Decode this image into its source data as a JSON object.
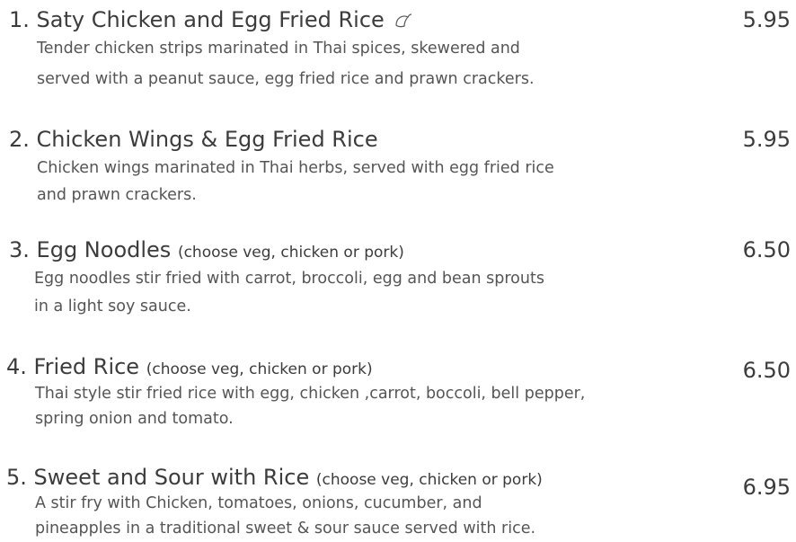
{
  "items": [
    {
      "number": "1.",
      "name": "Saty Chicken and Egg Fried Rice",
      "note": "",
      "icon": "chili-icon",
      "price": "5.95",
      "desc_line1": "Tender chicken strips marinated in Thai spices, skewered and",
      "desc_line2": "served with a peanut sauce, egg fried rice and prawn crackers."
    },
    {
      "number": "2.",
      "name": "Chicken Wings & Egg Fried Rice",
      "note": "",
      "price": "5.95",
      "desc_line1": "Chicken wings marinated in Thai herbs, served with egg fried rice",
      "desc_line2": "and prawn crackers."
    },
    {
      "number": "3.",
      "name": "Egg Noodles",
      "note": "(choose veg, chicken or pork)",
      "price": "6.50",
      "desc_line1": "Egg noodles stir fried with carrot, broccoli, egg and bean sprouts",
      "desc_line2": "in a light soy sauce."
    },
    {
      "number": "4.",
      "name": "Fried Rice",
      "note": "(choose veg, chicken or pork)",
      "price": "6.50",
      "desc_line1": "Thai style stir fried rice with egg, chicken ,carrot, boccoli, bell pepper,",
      "desc_line2": "spring onion and tomato."
    },
    {
      "number": "5.",
      "name": "Sweet and Sour with Rice",
      "note": "(choose veg, chicken or pork)",
      "price": "6.95",
      "desc_line1": "A stir fry with Chicken, tomatoes, onions, cucumber, and",
      "desc_line2": "pineapples in a traditional sweet & sour sauce served with rice."
    }
  ]
}
